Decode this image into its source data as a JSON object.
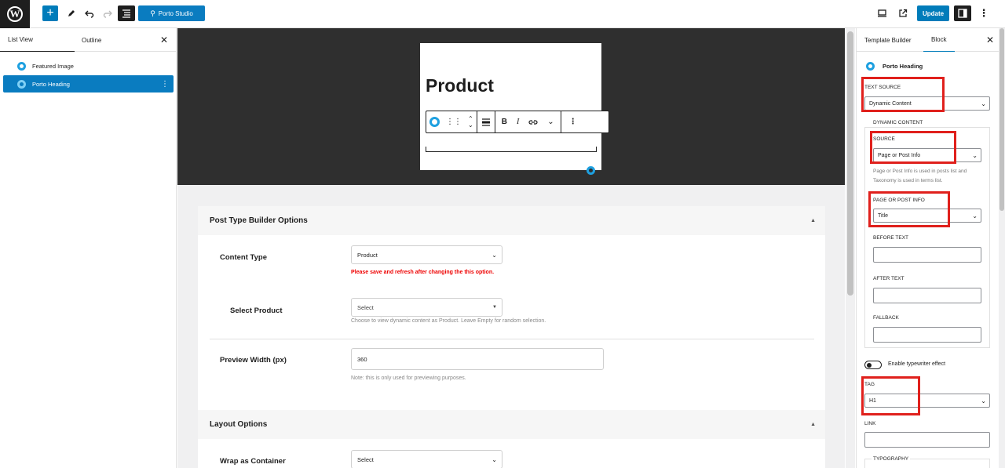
{
  "toolbar": {
    "studio_label": "Porto Studio",
    "update_label": "Update"
  },
  "left_panel": {
    "tabs": [
      "List View",
      "Outline"
    ],
    "items": [
      {
        "label": "Featured Image"
      },
      {
        "label": "Porto Heading"
      }
    ]
  },
  "canvas": {
    "preview_title": "Product",
    "sections": [
      {
        "title": "Post Type Builder Options"
      },
      {
        "title": "Layout Options"
      }
    ],
    "content_type": {
      "label": "Content Type",
      "value": "Product",
      "warning": "Please save and refresh after changing the this option."
    },
    "select_product": {
      "label": "Select Product",
      "value": "Select",
      "help": "Choose to view dynamic content as Product. Leave Empty for random selection."
    },
    "preview_width": {
      "label": "Preview Width (px)",
      "value": "360",
      "help": "Note: this is only used for previewing purposes."
    },
    "wrap_container": {
      "label": "Wrap as Container",
      "value": "Select"
    }
  },
  "sidebar": {
    "tabs": [
      "Template Builder",
      "Block"
    ],
    "block_name": "Porto Heading",
    "text_source": {
      "label": "TEXT SOURCE",
      "value": "Dynamic Content"
    },
    "dynamic_content_legend": "DYNAMIC CONTENT",
    "source": {
      "label": "SOURCE",
      "value": "Page or Post Info"
    },
    "source_help": "Page or Post Info is used in posts list and Taxonomy is used in terms list.",
    "page_post_info": {
      "label": "PAGE OR POST INFO",
      "value": "Title"
    },
    "before_text_label": "BEFORE TEXT",
    "after_text_label": "AFTER TEXT",
    "fallback_label": "FALLBACK",
    "typewriter_label": "Enable typewriter effect",
    "tag": {
      "label": "TAG",
      "value": "H1"
    },
    "link_label": "LINK",
    "typography_label": "TYPOGRAPHY"
  },
  "colors": {
    "accent": "#007cba",
    "highlight_box": "#e0201c",
    "dark_canvas": "#2f2f2f"
  }
}
